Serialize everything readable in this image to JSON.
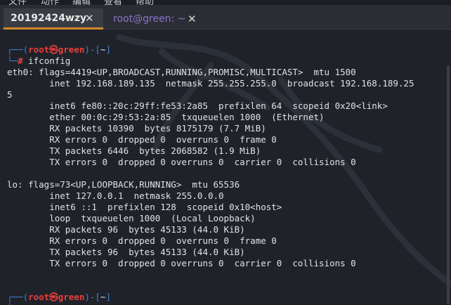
{
  "menubar": {
    "items": [
      "文件",
      "动作",
      "编辑",
      "查看",
      "帮助"
    ]
  },
  "tabs": [
    {
      "label": "20192424wzy",
      "close": "✕",
      "active": true
    },
    {
      "label": "root@green: ~",
      "close": "✕",
      "active": false
    }
  ],
  "colors": {
    "background": "#1f2229",
    "prompt_blue": "#3e7fd6",
    "prompt_red": "#e8403c",
    "tab_accent": "#d08a2c",
    "tab2_text": "#8d74c9"
  },
  "terminal": {
    "prompt1": {
      "corner": "┌──(",
      "user": "root㉿green",
      "mid": ")-[",
      "dir": "~",
      "end": "]",
      "cmd_corner": "└─",
      "hash": "# ",
      "command": "ifconfig"
    },
    "output": [
      "eth0: flags=4419<UP,BROADCAST,RUNNING,PROMISC,MULTICAST>  mtu 1500",
      "        inet 192.168.189.135  netmask 255.255.255.0  broadcast 192.168.189.25",
      "5",
      "        inet6 fe80::20c:29ff:fe53:2a85  prefixlen 64  scopeid 0x20<link>",
      "        ether 00:0c:29:53:2a:85  txqueuelen 1000  (Ethernet)",
      "        RX packets 10390  bytes 8175179 (7.7 MiB)",
      "        RX errors 0  dropped 0  overruns 0  frame 0",
      "        TX packets 6446  bytes 2068582 (1.9 MiB)",
      "        TX errors 0  dropped 0 overruns 0  carrier 0  collisions 0",
      "",
      "lo: flags=73<UP,LOOPBACK,RUNNING>  mtu 65536",
      "        inet 127.0.0.1  netmask 255.0.0.0",
      "        inet6 ::1  prefixlen 128  scopeid 0x10<host>",
      "        loop  txqueuelen 1000  (Local Loopback)",
      "        RX packets 96  bytes 45133 (44.0 KiB)",
      "        RX errors 0  dropped 0  overruns 0  frame 0",
      "        TX packets 96  bytes 45133 (44.0 KiB)",
      "        TX errors 0  dropped 0 overruns 0  carrier 0  collisions 0"
    ],
    "prompt2": {
      "corner": "┌──(",
      "user": "root㉿green",
      "mid": ")-[",
      "dir": "~",
      "end": "]",
      "cmd_corner": "└─"
    }
  }
}
